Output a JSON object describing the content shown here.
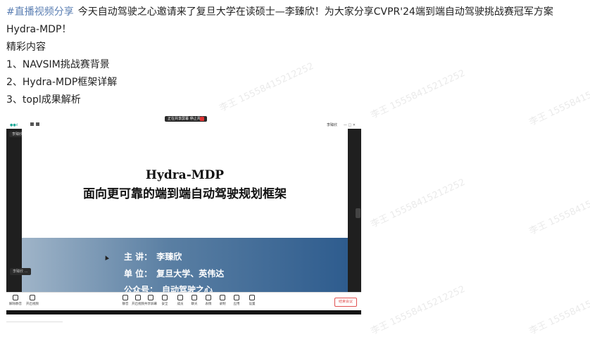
{
  "post": {
    "tag": "#直播视频分享",
    "intro": "今天自动驾驶之心邀请来了复旦大学在读硕士—李臻欣！为大家分享CVPR'24端到端自动驾驶挑战赛冠军方案",
    "intro_cont": "Hydra-MDP！",
    "section_title": "精彩内容",
    "items": [
      "1、NAVSIM挑战赛背景",
      "2、Hydra-MDP框架详解",
      "3、topl成果解析"
    ]
  },
  "watermark": "李王 15558415212252",
  "meeting": {
    "share_pill": "正在共享屏幕 停止共享",
    "user_name": "李臻欣",
    "speaker_tag": "李臻欣",
    "left_chip": "李臻欣 …",
    "toolbar": [
      {
        "label": "静音",
        "icon": "mic-icon"
      },
      {
        "label": "开启视频",
        "icon": "camera-icon"
      },
      {
        "label": "共享屏幕",
        "icon": "share-icon"
      },
      {
        "label": "安全",
        "icon": "shield-icon"
      },
      {
        "label": "成员",
        "icon": "members-icon"
      },
      {
        "label": "聊天",
        "icon": "chat-icon"
      },
      {
        "label": "表情",
        "icon": "emoji-icon"
      },
      {
        "label": "录制",
        "icon": "record-icon"
      },
      {
        "label": "应用",
        "icon": "apps-icon"
      },
      {
        "label": "设置",
        "icon": "gear-icon"
      }
    ],
    "left_controls": [
      "解除静音",
      "开启视频"
    ],
    "leave_label": "结束会议"
  },
  "slide": {
    "title": "Hydra-MDP",
    "subtitle": "面向更可靠的端到端自动驾驶规划框架",
    "meta": [
      {
        "key": "主  讲：",
        "value": "李臻欣"
      },
      {
        "key": "单  位：",
        "value": "复旦大学、英伟达"
      },
      {
        "key": "公众号：",
        "value": "自动驾驶之心"
      }
    ]
  }
}
